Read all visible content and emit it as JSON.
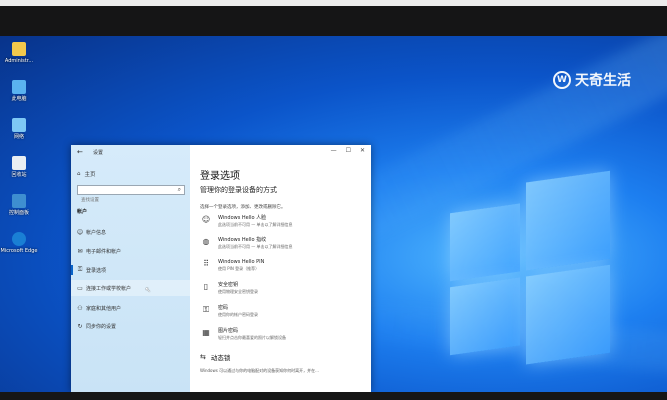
{
  "watermark": {
    "mark": "W",
    "text": "天奇生活"
  },
  "desktop_icons": [
    {
      "label": "Administr...",
      "color": "#f2c94c"
    },
    {
      "label": "此电脑",
      "color": "#5ab3f0"
    },
    {
      "label": "网络",
      "color": "#7ec8f5"
    },
    {
      "label": "回收站",
      "color": "#e8eef3"
    },
    {
      "label": "控制面板",
      "color": "#3e8ed0"
    },
    {
      "label": "Microsoft Edge",
      "color": "#1a7fd4"
    }
  ],
  "window": {
    "back": "←",
    "title": "设置",
    "min": "—",
    "max": "☐",
    "close": "✕"
  },
  "nav": {
    "home": "主页",
    "search_placeholder": "查找设置",
    "section": "帐户",
    "items": [
      {
        "label": "帐户信息",
        "icon": "☺"
      },
      {
        "label": "电子邮件和帐户",
        "icon": "✉"
      },
      {
        "label": "登录选项",
        "icon": "⚿"
      },
      {
        "label": "连接工作或学校帐户",
        "icon": "▭"
      },
      {
        "label": "家庭和其他用户",
        "icon": "⚇"
      },
      {
        "label": "同步你的设置",
        "icon": "↻"
      }
    ]
  },
  "content": {
    "heading": "登录选项",
    "subheading": "管理你的登录设备的方式",
    "intro": "选择一个登录选项，添加、更改或删除它。",
    "options": [
      {
        "icon": "☺",
        "title": "Windows Hello 人脸",
        "desc": "此选项当前不可用 — 单击以了解详细信息"
      },
      {
        "icon": "◍",
        "title": "Windows Hello 指纹",
        "desc": "此选项当前不可用 — 单击以了解详细信息"
      },
      {
        "icon": "⠿",
        "title": "Windows Hello PIN",
        "desc": "使用 PIN 登录（推荐）"
      },
      {
        "icon": "▯",
        "title": "安全密钥",
        "desc": "使用物理安全密钥登录"
      },
      {
        "icon": "⚿",
        "title": "密码",
        "desc": "使用你的帐户密码登录"
      },
      {
        "icon": "▦",
        "title": "图片密码",
        "desc": "轻扫并点击你最喜爱的照片以解锁设备"
      }
    ],
    "dynamic_lock": {
      "icon": "⇆",
      "title": "动态锁",
      "desc": "Windows 可以通过与你的电脑配对的设备获知你何时离开，并在..."
    }
  }
}
